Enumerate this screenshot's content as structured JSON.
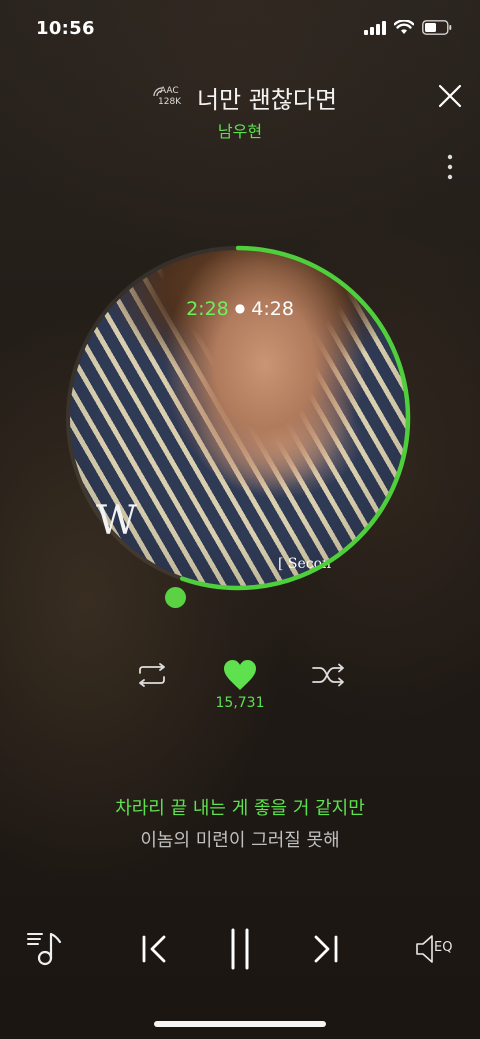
{
  "status_bar": {
    "time": "10:56"
  },
  "header": {
    "quality_codec": "AAC",
    "quality_bitrate": "128K",
    "title": "너만 괜찮다면",
    "artist": "남우현"
  },
  "player": {
    "current_time": "2:28",
    "total_time": "4:28",
    "progress_fraction": 0.553,
    "album_logo": "W",
    "album_subtitle": "[ Secon",
    "like_count": "15,731",
    "liked": true
  },
  "lyrics": {
    "current_line": "차라리 끝 내는 게 좋을 거 같지만",
    "next_line": "이놈의 미련이 그러질 못해"
  },
  "bottom_bar": {
    "eq_label": "EQ"
  },
  "colors": {
    "accent": "#5ee04f",
    "ring": "#4fcf3c",
    "background": "#221c17"
  },
  "icons": [
    "close-icon",
    "more-vertical-icon",
    "repeat-icon",
    "heart-icon",
    "shuffle-icon",
    "playlist-icon",
    "previous-icon",
    "pause-icon",
    "next-icon",
    "equalizer-icon",
    "signal-icon",
    "wifi-icon",
    "battery-icon"
  ]
}
